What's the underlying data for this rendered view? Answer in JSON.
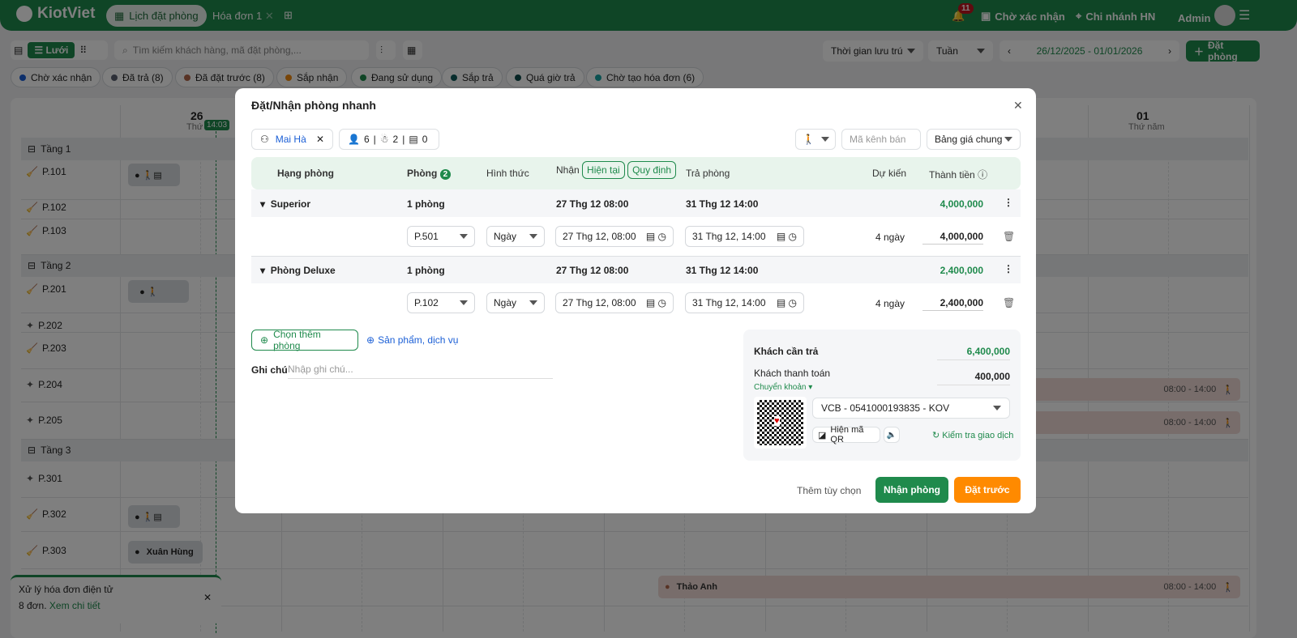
{
  "header": {
    "brand": "KiotViet",
    "tabs": [
      {
        "label": "Lịch đặt phòng"
      },
      {
        "label": "Hóa đơn 1"
      }
    ],
    "notif_count": "11",
    "pending": "Chờ xác nhận",
    "branch": "Chi nhánh HN",
    "user": "Admin"
  },
  "toolbar": {
    "view_label": "Lưới",
    "search_placeholder": "Tìm kiếm khách hàng, mã đặt phòng,...",
    "time_filter": "Thời gian lưu trú",
    "period": "Tuần",
    "date_range": "26/12/2025 - 01/01/2026",
    "book_button": "Đặt phòng"
  },
  "status_chips": [
    {
      "label": "Chờ xác nhận",
      "color": "#1b5fd6"
    },
    {
      "label": "Đã trả (8)",
      "color": "#5a6170"
    },
    {
      "label": "Đã đặt trước (8)",
      "color": "#b0674a"
    },
    {
      "label": "Sắp nhận",
      "color": "#f08a10"
    },
    {
      "label": "Đang sử dụng",
      "color": "#1f8a4c"
    },
    {
      "label": "Sắp trả",
      "color": "#0e5a5a"
    },
    {
      "label": "Quá giờ trả",
      "color": "#0d4a4a"
    },
    {
      "label": "Chờ tạo hóa đơn (6)",
      "color": "#16a3a3"
    }
  ],
  "calendar": {
    "days": [
      {
        "num": "26",
        "name": "Thứ sáu"
      },
      {
        "num": "01",
        "name": "Thứ năm"
      }
    ],
    "now": "14:03",
    "floors": [
      "Tầng 1",
      "Tầng 2",
      "Tầng 3"
    ],
    "rooms": [
      "P.101",
      "P.102",
      "P.103",
      "P.201",
      "P.202",
      "P.203",
      "P.204",
      "P.205",
      "P.301",
      "P.302",
      "P.303"
    ],
    "bookings": {
      "p303": "Xuân Hùng",
      "thao": "Thảo Anh",
      "time": "08:00 - 14:00"
    }
  },
  "toast": {
    "title": "Xử lý hóa đơn điện tử",
    "count": "8 đơn.",
    "link": "Xem chi tiết"
  },
  "modal": {
    "title": "Đặt/Nhận phòng nhanh",
    "customer": "Mai Hà",
    "adults": "6",
    "children": "2",
    "ids": "0",
    "channel_placeholder": "Mã kênh bán",
    "price_list": "Bảng giá chung",
    "cols": {
      "type": "Hạng phòng",
      "room": "Phòng",
      "room_count": "2",
      "form": "Hình thức",
      "checkin": "Nhận",
      "now": "Hiện tại",
      "rule": "Quy định",
      "checkout": "Trả phòng",
      "est": "Dự kiến",
      "total": "Thành tiền"
    },
    "groups": [
      {
        "name": "Superior",
        "count": "1 phòng",
        "checkin": "27 Thg 12 08:00",
        "checkout": "31 Thg 12 14:00",
        "total": "4,000,000",
        "room": "P.501",
        "form": "Ngày",
        "in": "27 Thg 12, 08:00",
        "out": "31 Thg 12, 14:00",
        "est": "4 ngày",
        "price": "4,000,000"
      },
      {
        "name": "Phòng Deluxe",
        "count": "1 phòng",
        "checkin": "27 Thg 12 08:00",
        "checkout": "31 Thg 12 14:00",
        "total": "2,400,000",
        "room": "P.102",
        "form": "Ngày",
        "in": "27 Thg 12, 08:00",
        "out": "31 Thg 12, 14:00",
        "est": "4 ngày",
        "price": "2,400,000"
      }
    ],
    "add_room": "Chọn thêm phòng",
    "add_service": "Sản phẩm, dịch vụ",
    "note_label": "Ghi chú",
    "note_placeholder": "Nhập ghi chú...",
    "payment": {
      "due_label": "Khách cần trả",
      "due": "6,400,000",
      "paid_label": "Khách thanh toán",
      "paid": "400,000",
      "method": "Chuyển khoản",
      "account": "VCB - 0541000193835 - KOV",
      "show_qr": "Hiện mã QR",
      "check_tx": "Kiểm tra giao dịch"
    },
    "more": "Thêm tùy chọn",
    "checkin_btn": "Nhận phòng",
    "reserve_btn": "Đặt trước"
  }
}
